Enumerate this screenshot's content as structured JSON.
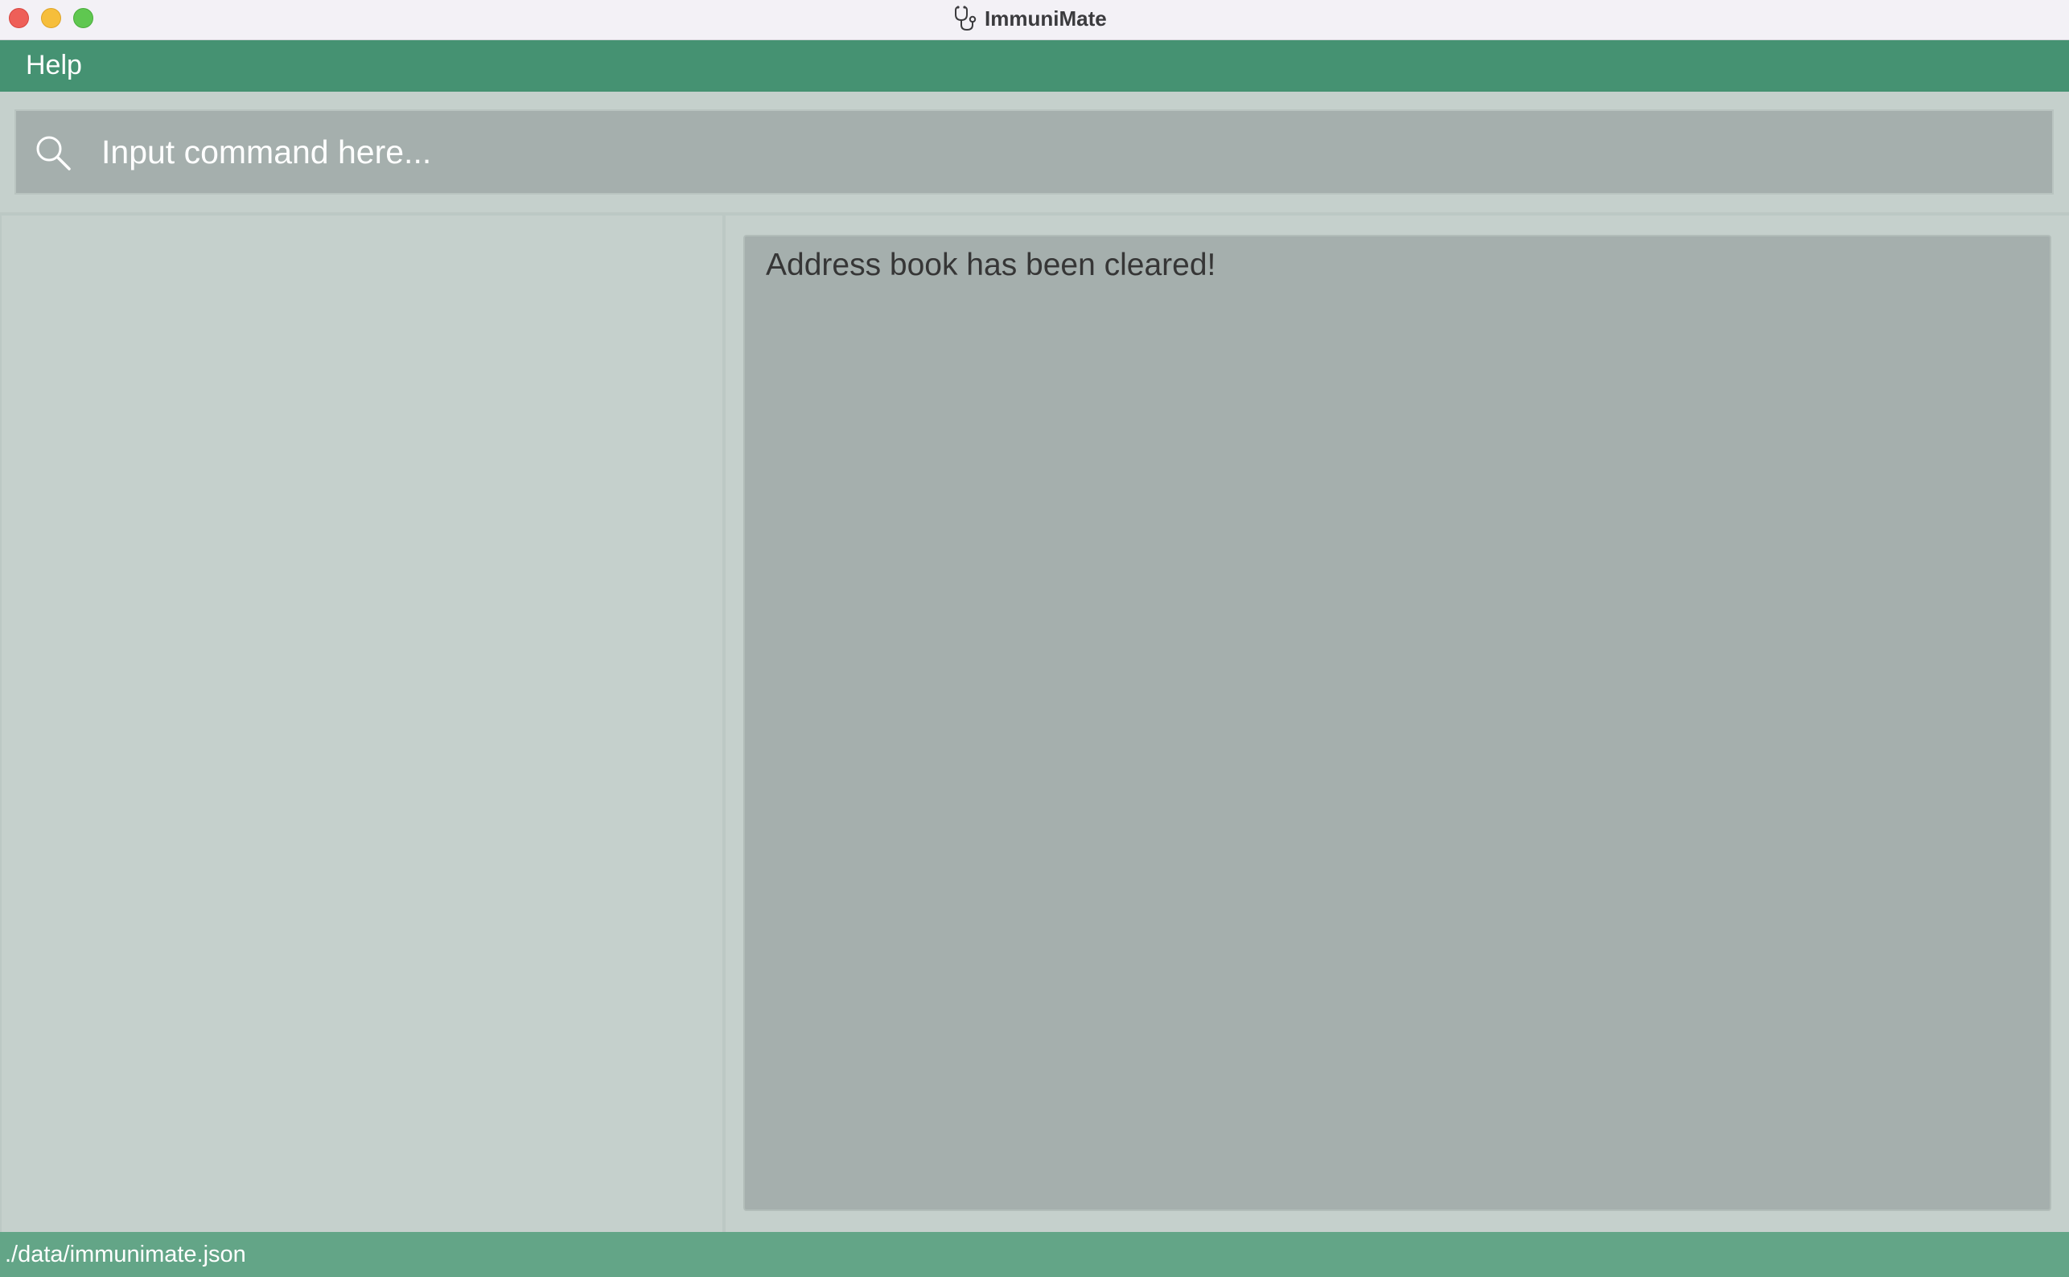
{
  "window": {
    "title": "ImmuniMate",
    "app_icon": "stethoscope-icon",
    "controls": [
      "close",
      "minimize",
      "maximize"
    ]
  },
  "menu": {
    "items": [
      {
        "label": "Help"
      }
    ]
  },
  "command": {
    "icon": "search-icon",
    "placeholder": "Input command here...",
    "value": ""
  },
  "result": {
    "message": "Address book has been cleared!"
  },
  "status": {
    "file_path": "./data/immunimate.json"
  },
  "colors": {
    "accent_green": "#459272",
    "status_green": "#63a587",
    "panel_bg": "#c5d0cc",
    "box_bg": "#a5afad"
  }
}
